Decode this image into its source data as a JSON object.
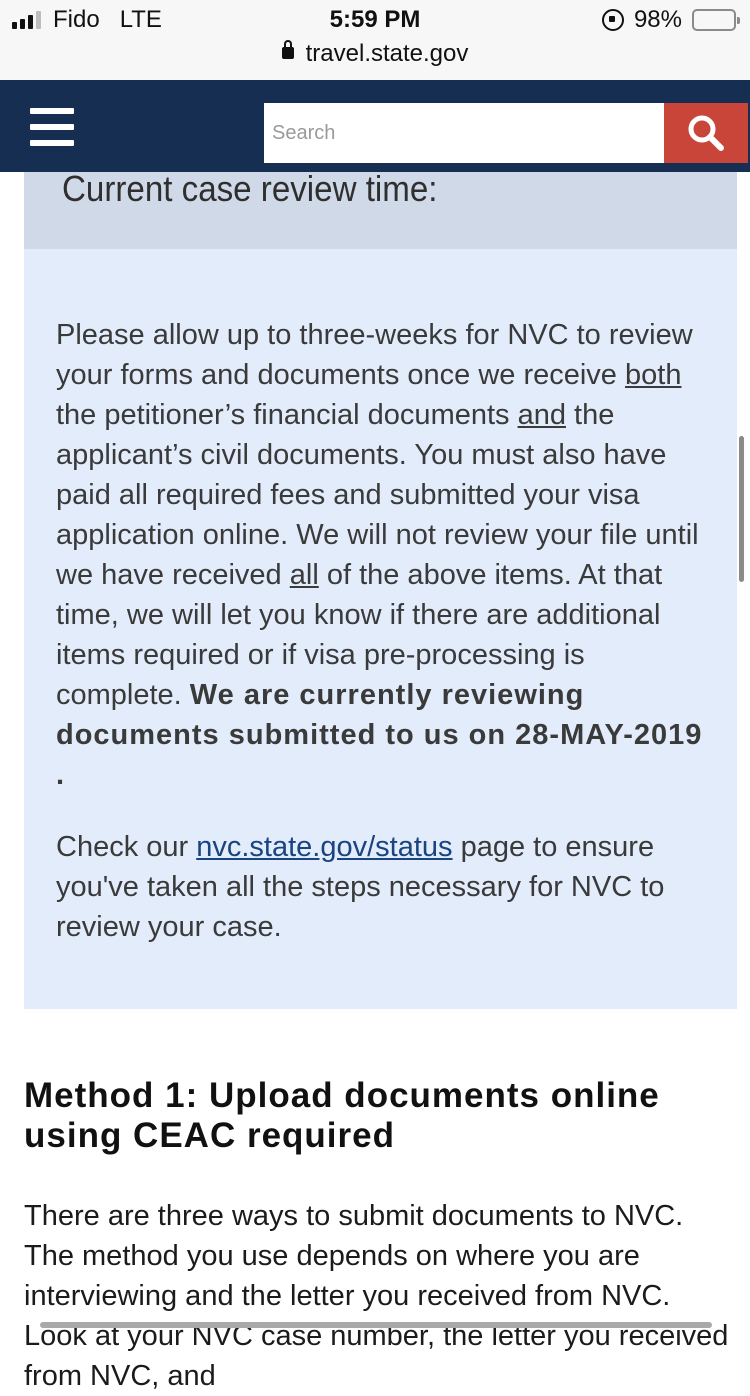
{
  "status_bar": {
    "carrier": "Fido",
    "network": "LTE",
    "time": "5:59 PM",
    "battery_percent": "98%",
    "battery_level": 0.98,
    "url": "travel.state.gov"
  },
  "header": {
    "menu_icon": "hamburger-menu-icon",
    "search_placeholder": "Search",
    "search_icon": "magnifier-icon"
  },
  "callout": {
    "title": "Current case review time:",
    "p1_a": "Please allow up to three-weeks for NVC to review your forms and documents once we receive ",
    "p1_both": "both",
    "p1_b": " the petitioner’s financial documents ",
    "p1_and": "and",
    "p1_c": " the applicant’s civil documents. You must also have paid all required fees and submitted your visa application online. We will not review your file until we have received ",
    "p1_all": "all",
    "p1_d": " of the above items. At that time, we will let you know if there are additional items required or if visa pre-processing is complete. ",
    "p1_bold": "We are currently reviewing documents submitted to us on 28-MAY-2019 .",
    "p2_a": "Check our ",
    "p2_link": "nvc.state.gov/status",
    "p2_b": " page to ensure you've taken all the steps necessary for NVC to review your case."
  },
  "method": {
    "title": "Method 1: Upload documents online using CEAC required",
    "body": "There are three ways to submit documents to NVC. The method you use depends on where you are interviewing and the letter you received from NVC. Look at your NVC case number, the letter you received from NVC, and"
  },
  "colors": {
    "navbar": "#162e51",
    "search_button": "#c9453a",
    "callout_header": "#cfd9e8",
    "callout_body": "#e2ecfb",
    "link": "#1a4480"
  }
}
